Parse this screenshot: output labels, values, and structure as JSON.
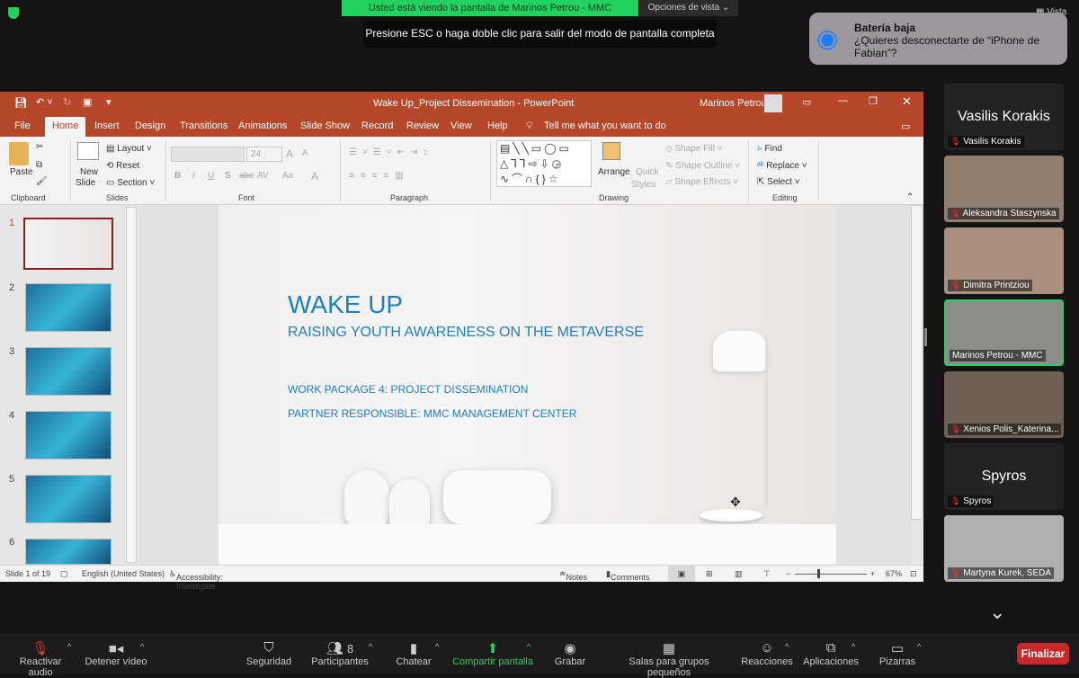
{
  "zoom_top": {
    "sharing_banner": "Usted está viendo la pantalla de Marinos Petrou - MMC",
    "view_options": "Opciones de vista",
    "esc_message": "Presione ESC o haga doble clic para salir del modo de pantalla completa",
    "view_label": "Vista"
  },
  "notification": {
    "title": "Batería baja",
    "message": "¿Quieres desconectarte de “iPhone de Fabian”?",
    "icon": "wifi-icon",
    "accent": "#1a7cff"
  },
  "ppt": {
    "title": "Wake Up_Project Dissemination  -  PowerPoint",
    "user": "Marinos Petrou",
    "accent": "#b7472a",
    "tabs": [
      "File",
      "Home",
      "Insert",
      "Design",
      "Transitions",
      "Animations",
      "Slide Show",
      "Record",
      "Review",
      "View",
      "Help"
    ],
    "active_tab": "Home",
    "tell_me": "Tell me what you want to do",
    "ribbon": {
      "paste": "Paste",
      "clipboard": "Clipboard",
      "new_slide": "New",
      "new_slide2": "Slide",
      "layout": "Layout",
      "reset": "Reset",
      "section": "Section",
      "slides": "Slides",
      "font_size": "24",
      "font": "Font",
      "paragraph": "Paragraph",
      "arrange": "Arrange",
      "quick_styles": "Quick",
      "quick_styles2": "Styles",
      "shape_fill": "Shape Fill",
      "shape_outline": "Shape Outline",
      "shape_effects": "Shape Effects",
      "drawing": "Drawing",
      "find": "Find",
      "replace": "Replace",
      "select": "Select",
      "editing": "Editing",
      "bold": "B",
      "italic": "I",
      "underline": "U",
      "strike": "S",
      "font_grow": "A",
      "font_shrink": "A",
      "char_spacing": "AV",
      "change_case": "Aa",
      "font_color": "A"
    },
    "thumbnails": [
      "1",
      "2",
      "3",
      "4",
      "5",
      "6"
    ],
    "slide": {
      "title": "WAKE UP",
      "subtitle": "RAISING YOUTH AWARENESS ON THE METAVERSE",
      "line1": "WORK PACKAGE 4: PROJECT DISSEMINATION",
      "line2": "PARTNER RESPONSIBLE: MMC MANAGEMENT CENTER",
      "text_color": "#1b7fc4"
    },
    "status": {
      "slide": "Slide 1 of 19",
      "language": "English (United States)",
      "accessibility": "Accessibility: Investigate",
      "notes": "Notes",
      "comments": "Comments",
      "zoom": "67%",
      "zoom_value": 67
    }
  },
  "participants": [
    {
      "name": "Vasilis Korakis",
      "video": false
    },
    {
      "name": "Aleksandra Staszynska",
      "video": true
    },
    {
      "name": "Dimitra Printziou",
      "video": true
    },
    {
      "name": "Marinos Petrou - MMC",
      "video": true,
      "active_speaker": true
    },
    {
      "name": "Xenios Polis_Katerina...",
      "video": true
    },
    {
      "name": "Spyros",
      "video": false
    },
    {
      "name": "Martyna Kurek, SEDA",
      "video": true
    }
  ],
  "toolbar": {
    "items": [
      {
        "label": "Reactivar audio",
        "icon": "mic-muted-icon"
      },
      {
        "label": "Detener vídeo",
        "icon": "video-icon"
      },
      {
        "label": "Seguridad",
        "icon": "shield-icon"
      },
      {
        "label": "Participantes",
        "icon": "participants-icon",
        "count": "8"
      },
      {
        "label": "Chatear",
        "icon": "chat-icon"
      },
      {
        "label": "Compartir pantalla",
        "icon": "share-screen-icon"
      },
      {
        "label": "Grabar",
        "icon": "record-icon"
      },
      {
        "label": "Salas para grupos pequeños",
        "icon": "breakout-icon"
      },
      {
        "label": "Reacciones",
        "icon": "reactions-icon"
      },
      {
        "label": "Aplicaciones",
        "icon": "apps-icon"
      },
      {
        "label": "Pizarras",
        "icon": "whiteboard-icon"
      }
    ],
    "end": "Finalizar",
    "share_color": "#23d160",
    "end_color": "#c8272c"
  }
}
